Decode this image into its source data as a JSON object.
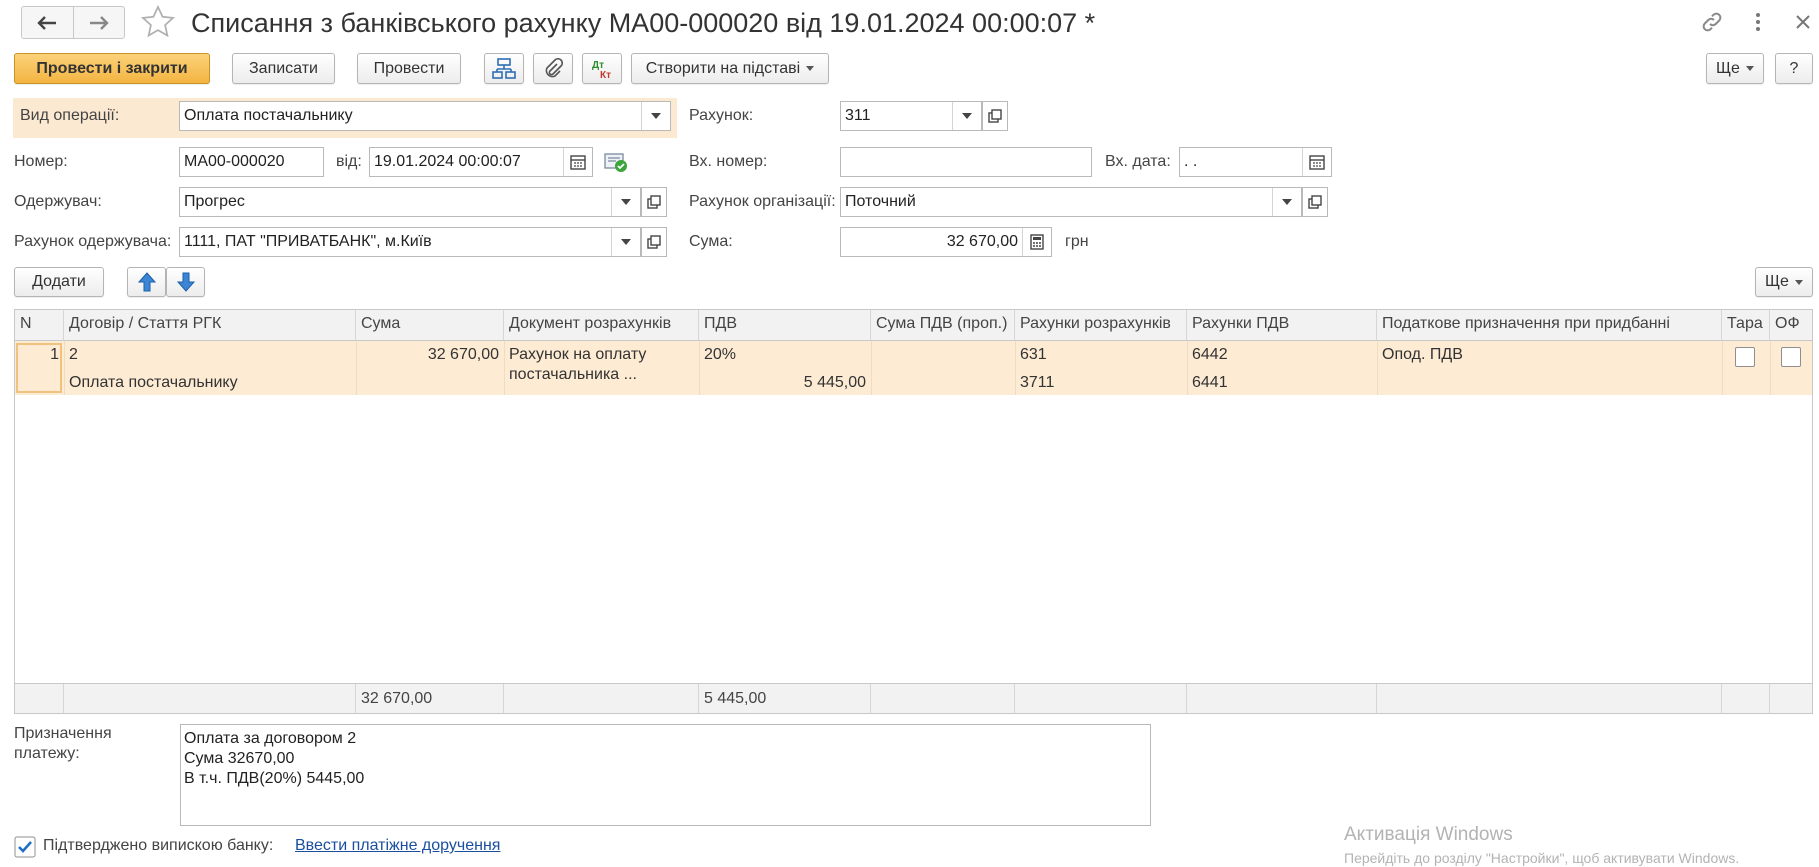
{
  "window": {
    "title": "Списання з банківського рахунку МА00-000020 від 19.01.2024 00:00:07 *"
  },
  "toolbar": {
    "post_close": "Провести і закрити",
    "save": "Записати",
    "post": "Провести",
    "create_based": "Створити на підставі",
    "more": "Ще",
    "help": "?"
  },
  "form": {
    "operation_label": "Вид операції:",
    "operation_value": "Оплата постачальнику",
    "account_label": "Рахунок:",
    "account_value": "311",
    "number_label": "Номер:",
    "number_value": "МА00-000020",
    "date_label": "від:",
    "date_value": "19.01.2024 00:00:07",
    "in_number_label": "Вх. номер:",
    "in_number_value": "",
    "in_date_label": "Вх. дата:",
    "in_date_value": " .  .",
    "recipient_label": "Одержувач:",
    "recipient_value": "Прогрес",
    "org_account_label": "Рахунок організації:",
    "org_account_value": "Поточний",
    "recipient_account_label": "Рахунок одержувача:",
    "recipient_account_value": "1111, ПАТ \"ПРИВАТБАНК\", м.Київ",
    "sum_label": "Сума:",
    "sum_value": "32 670,00",
    "currency": "грн"
  },
  "table_toolbar": {
    "add": "Додати",
    "more": "Ще"
  },
  "table": {
    "columns": [
      "N",
      "Договір / Стаття РГК",
      "Сума",
      "Документ розрахунків",
      "ПДВ",
      "Сума ПДВ (проп.)",
      "Рахунки розрахунків",
      "Рахунки ПДВ",
      "Податкове призначення при придбанні",
      "Тара",
      "ОФ"
    ],
    "row": {
      "n": "1",
      "contract": "2",
      "article": "Оплата постачальнику",
      "sum": "32 670,00",
      "doc_line1": "Рахунок на оплату",
      "doc_line2": "постачальника ...",
      "vat_rate": "20%",
      "vat_sum": "5 445,00",
      "settle_acc1": "631",
      "settle_acc2": "3711",
      "vat_acc1": "6442",
      "vat_acc2": "6441",
      "tax_purpose": "Опод. ПДВ"
    },
    "totals": {
      "sum": "32 670,00",
      "vat": "5 445,00"
    }
  },
  "purpose": {
    "label_line1": "Призначення",
    "label_line2": "платежу:",
    "line1": "Оплата за договором 2",
    "line2": "Сума 32670,00",
    "line3": "В т.ч. ПДВ(20%) 5445,00"
  },
  "bottom": {
    "confirmed_label": "Підтверджено випискою банку:",
    "link": "Ввести платіжне доручення"
  },
  "watermark": {
    "line1": "Активація Windows",
    "line2": "Перейдіть до розділу \"Настройки\", щоб активувати Windows."
  }
}
